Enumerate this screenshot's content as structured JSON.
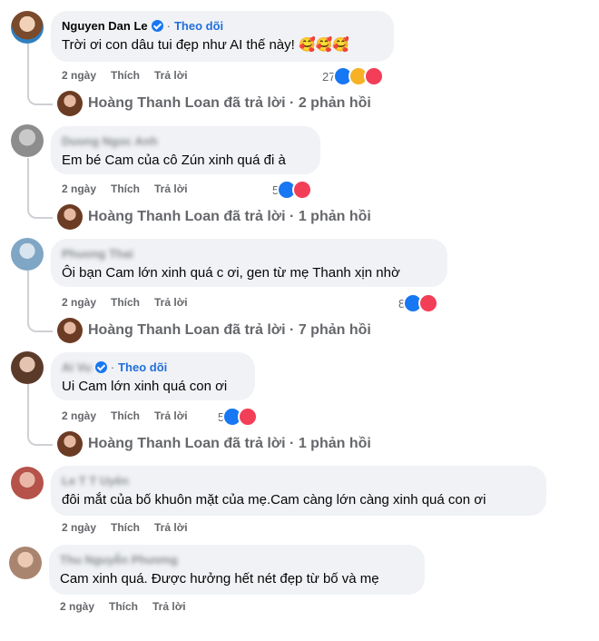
{
  "labels": {
    "like": "Thích",
    "reply": "Trả lời",
    "follow": "Theo dõi",
    "sep": "·"
  },
  "comments": [
    {
      "name": "Nguyen Dan Le",
      "verified": true,
      "follow": true,
      "text": "Trời ơi con dâu tui đẹp như AI thế này! 🥰🥰🥰",
      "time": "2 ngày",
      "reactions": {
        "count": "27",
        "icons": [
          "like-icon",
          "haha-icon",
          "love-icon"
        ]
      },
      "replies_summary": "Hoàng Thanh Loan đã trả lời · 2 phản hồi"
    },
    {
      "name": "Duong Ngoc Anh",
      "blurred": true,
      "text": "Em bé Cam của cô Zún xinh quá đi à",
      "time": "2 ngày",
      "reactions": {
        "count": "5",
        "icons": [
          "like-icon",
          "love-icon"
        ]
      },
      "replies_summary": "Hoàng Thanh Loan đã trả lời · 1 phản hồi"
    },
    {
      "name": "Phuong Thai",
      "blurred": true,
      "text": "Ôi bạn Cam lớn xinh quá c ơi, gen từ mẹ Thanh xịn nhờ",
      "time": "2 ngày",
      "reactions": {
        "count": "8",
        "icons": [
          "like-icon",
          "love-icon"
        ]
      },
      "replies_summary": "Hoàng Thanh Loan đã trả lời · 7 phản hồi"
    },
    {
      "name": "Ai Vu",
      "blurred": true,
      "verified": true,
      "follow": true,
      "text": "Ui Cam lớn xinh quá con ơi",
      "time": "2 ngày",
      "reactions": {
        "count": "5",
        "icons": [
          "like-icon",
          "love-icon"
        ]
      },
      "replies_summary": "Hoàng Thanh Loan đã trả lời · 1 phản hồi"
    },
    {
      "name": "Le T T Uyên",
      "blurred": true,
      "text": "đôi mắt của bố khuôn mặt của mẹ.Cam càng lớn càng xinh quá con ơi",
      "time": "2 ngày"
    },
    {
      "name": "Thu Nguyễn Phương",
      "blurred": true,
      "text": "Cam xinh quá. Được hưởng hết nét đẹp từ bố và mẹ",
      "time": "2 ngày"
    }
  ]
}
